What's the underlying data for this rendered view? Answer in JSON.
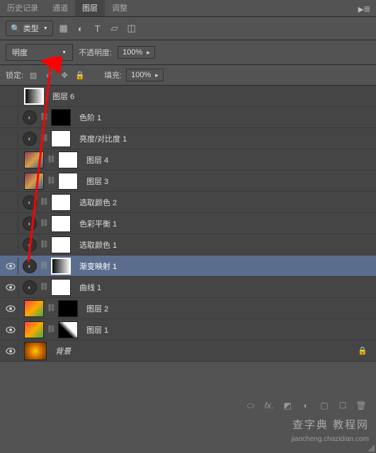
{
  "tabs": {
    "history": "历史记录",
    "channels": "通道",
    "layers": "图层",
    "adjustments": "调整"
  },
  "filter": {
    "label": "类型"
  },
  "blend": {
    "mode": "明度",
    "opacity_label": "不透明度:",
    "opacity_value": "100%"
  },
  "lock": {
    "label": "锁定:",
    "fill_label": "填充:",
    "fill_value": "100%"
  },
  "layers": [
    {
      "name": "图层 6",
      "visible": false,
      "type": "raster",
      "thumb": "gradient"
    },
    {
      "name": "色阶 1",
      "visible": false,
      "type": "adj",
      "thumb": "mask-black"
    },
    {
      "name": "亮度/对比度 1",
      "visible": false,
      "type": "adj",
      "thumb": "white"
    },
    {
      "name": "图层 4",
      "visible": false,
      "type": "masked",
      "thumb": "img1",
      "mask": "white"
    },
    {
      "name": "图层 3",
      "visible": false,
      "type": "masked",
      "thumb": "img1",
      "mask": "white"
    },
    {
      "name": "选取颜色 2",
      "visible": false,
      "type": "adj",
      "thumb": "white"
    },
    {
      "name": "色彩平衡 1",
      "visible": false,
      "type": "adj",
      "thumb": "white"
    },
    {
      "name": "选取颜色 1",
      "visible": false,
      "type": "adj",
      "thumb": "white"
    },
    {
      "name": "渐变映射 1",
      "visible": true,
      "type": "adj",
      "thumb": "gradient",
      "selected": true
    },
    {
      "name": "曲线 1",
      "visible": true,
      "type": "adj",
      "thumb": "white"
    },
    {
      "name": "图层 2",
      "visible": true,
      "type": "masked",
      "thumb": "img2",
      "mask": "mask-black"
    },
    {
      "name": "图层 1",
      "visible": true,
      "type": "masked",
      "thumb": "img2",
      "mask": "mixed"
    },
    {
      "name": "背景",
      "visible": true,
      "type": "bg",
      "thumb": "img3",
      "locked": true
    }
  ],
  "watermark": {
    "text": "查字典 教程网",
    "url": "jiaocheng.chazidian.com"
  }
}
